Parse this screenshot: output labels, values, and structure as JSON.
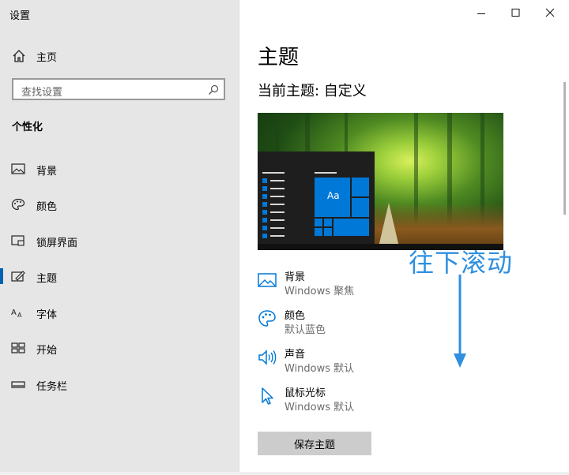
{
  "window": {
    "title": "设置"
  },
  "sidebar": {
    "home_label": "主页",
    "search_placeholder": "查找设置",
    "section_title": "个性化",
    "items": [
      {
        "label": "背景",
        "icon": "image-icon",
        "selected": false
      },
      {
        "label": "颜色",
        "icon": "palette-icon",
        "selected": false
      },
      {
        "label": "锁屏界面",
        "icon": "lock-screen-icon",
        "selected": false
      },
      {
        "label": "主题",
        "icon": "theme-brush-icon",
        "selected": true
      },
      {
        "label": "字体",
        "icon": "font-icon",
        "selected": false
      },
      {
        "label": "开始",
        "icon": "start-grid-icon",
        "selected": false
      },
      {
        "label": "任务栏",
        "icon": "taskbar-icon",
        "selected": false
      }
    ]
  },
  "main": {
    "page_title": "主题",
    "current_theme": "当前主题: 自定义",
    "preview_tile_label": "Aa",
    "options": [
      {
        "name": "背景",
        "value": "Windows 聚焦",
        "icon": "image-icon"
      },
      {
        "name": "颜色",
        "value": "默认蓝色",
        "icon": "palette-icon"
      },
      {
        "name": "声音",
        "value": "Windows 默认",
        "icon": "speaker-icon"
      },
      {
        "name": "鼠标光标",
        "value": "Windows 默认",
        "icon": "cursor-icon"
      }
    ],
    "save_button": "保存主题"
  },
  "annotation": {
    "text": "往下滚动"
  },
  "colors": {
    "accent": "#0078d7",
    "annotation": "#2f8fe0",
    "sidebar_bg": "#e6e6e6"
  }
}
